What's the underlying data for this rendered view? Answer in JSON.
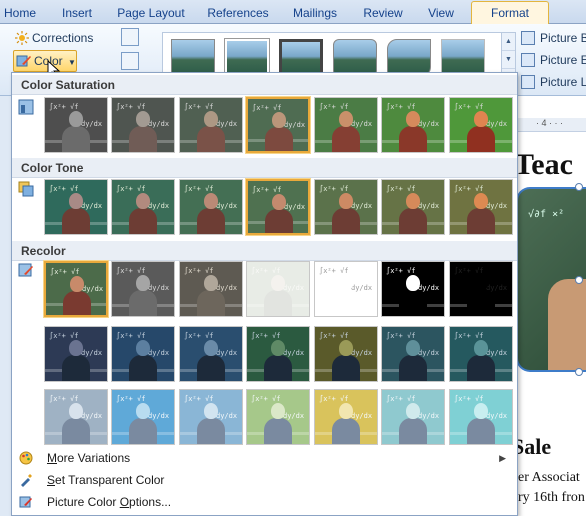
{
  "tabs": [
    {
      "label": "Home",
      "active": false
    },
    {
      "label": "Insert",
      "active": false
    },
    {
      "label": "Page Layout",
      "active": false
    },
    {
      "label": "References",
      "active": false
    },
    {
      "label": "Mailings",
      "active": false
    },
    {
      "label": "Review",
      "active": false
    },
    {
      "label": "View",
      "active": false
    },
    {
      "label": "Format",
      "active": true
    }
  ],
  "ribbon": {
    "corrections_label": "Corrections",
    "color_label": "Color",
    "right_commands": [
      "Picture Bo",
      "Picture Eff",
      "Picture La"
    ]
  },
  "panel": {
    "sections": [
      {
        "title": "Color Saturation",
        "selected_index": 3
      },
      {
        "title": "Color Tone",
        "selected_index": 3
      },
      {
        "title": "Recolor",
        "selected_index": 0
      }
    ],
    "menu_items": [
      {
        "label": "More Variations",
        "has_submenu": true,
        "icon": "palette-icon"
      },
      {
        "label": "Set Transparent Color",
        "has_submenu": false,
        "icon": "eyedropper-icon"
      },
      {
        "label": "Picture Color Options...",
        "has_submenu": false,
        "icon": "picture-color-options-icon"
      }
    ]
  },
  "document": {
    "heading": "Teac",
    "subheading": "Sale",
    "lines": [
      "er Associat",
      "ry 16th fron"
    ]
  },
  "colors": {
    "selection_border": "#e9a93b",
    "active_tab_border": "#e3b53e",
    "panel_header_bg": "#e9eef5"
  }
}
